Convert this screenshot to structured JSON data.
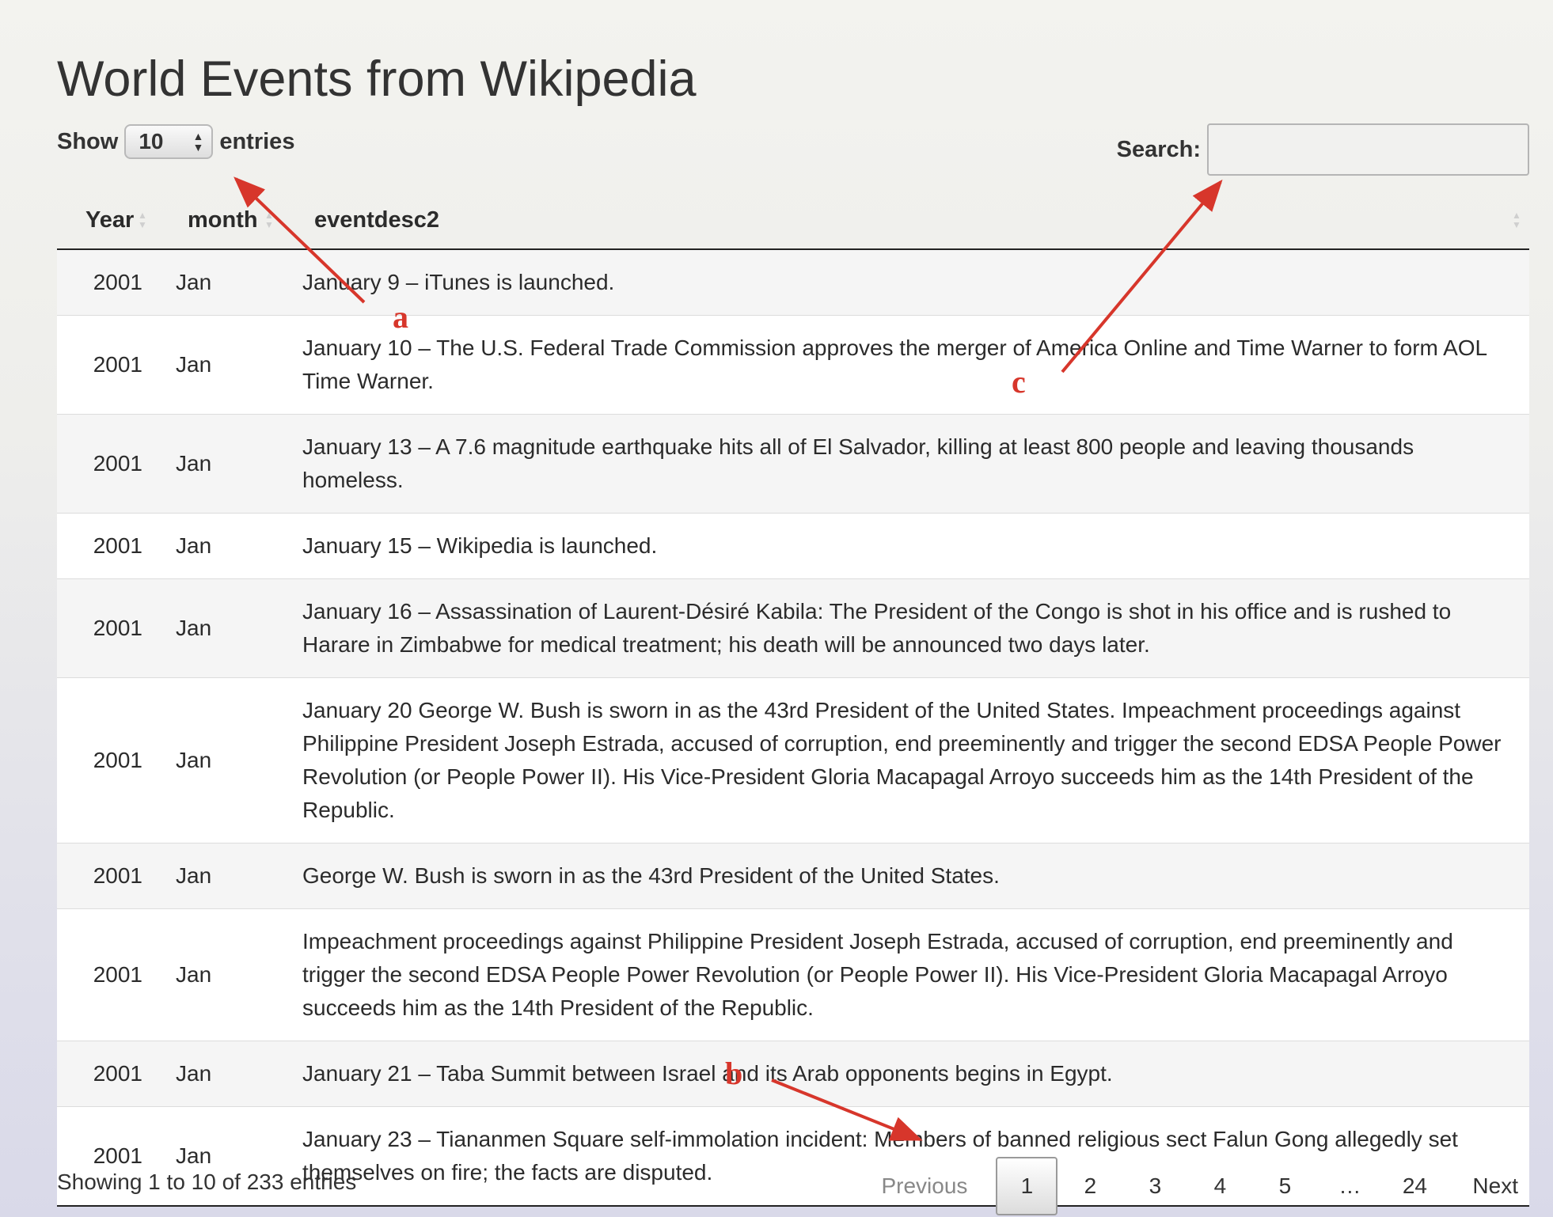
{
  "page": {
    "title": "World Events from Wikipedia"
  },
  "length": {
    "label_before": "Show",
    "selected": "10",
    "label_after": "entries"
  },
  "search": {
    "label": "Search:",
    "value": "",
    "placeholder": ""
  },
  "table": {
    "columns": [
      "Year",
      "month",
      "eventdesc2"
    ],
    "rows": [
      {
        "year": "2001",
        "month": "Jan",
        "desc": "January 9 – iTunes is launched."
      },
      {
        "year": "2001",
        "month": "Jan",
        "desc": "January 10 – The U.S. Federal Trade Commission approves the merger of America Online and Time Warner to form AOL Time Warner."
      },
      {
        "year": "2001",
        "month": "Jan",
        "desc": "January 13 – A 7.6 magnitude earthquake hits all of El Salvador, killing at least 800 people and leaving thousands homeless."
      },
      {
        "year": "2001",
        "month": "Jan",
        "desc": "January 15 – Wikipedia is launched."
      },
      {
        "year": "2001",
        "month": "Jan",
        "desc": "January 16 – Assassination of Laurent-Désiré Kabila: The President of the Congo is shot in his office and is rushed to Harare in Zimbabwe for medical treatment; his death will be announced two days later."
      },
      {
        "year": "2001",
        "month": "Jan",
        "desc": "January 20 George W. Bush is sworn in as the 43rd President of the United States. Impeachment proceedings against Philippine President Joseph Estrada, accused of corruption, end preeminently and trigger the second EDSA People Power Revolution (or People Power II). His Vice-President Gloria Macapagal Arroyo succeeds him as the 14th President of the Republic."
      },
      {
        "year": "2001",
        "month": "Jan",
        "desc": "George W. Bush is sworn in as the 43rd President of the United States."
      },
      {
        "year": "2001",
        "month": "Jan",
        "desc": "Impeachment proceedings against Philippine President Joseph Estrada, accused of corruption, end preeminently and trigger the second EDSA People Power Revolution (or People Power II). His Vice-President Gloria Macapagal Arroyo succeeds him as the 14th President of the Republic."
      },
      {
        "year": "2001",
        "month": "Jan",
        "desc": "January 21 – Taba Summit between Israel and its Arab opponents begins in Egypt."
      },
      {
        "year": "2001",
        "month": "Jan",
        "desc": "January 23 – Tiananmen Square self-immolation incident: Members of banned religious sect Falun Gong allegedly set themselves on fire; the facts are disputed."
      }
    ]
  },
  "info": {
    "text": "Showing 1 to 10 of 233 entries"
  },
  "pagination": {
    "previous": "Previous",
    "pages": [
      "1",
      "2",
      "3",
      "4",
      "5",
      "…",
      "24"
    ],
    "current": "1",
    "next": "Next"
  },
  "annotations": {
    "a": "a",
    "b": "b",
    "c": "c",
    "color": "#d7362b"
  },
  "icons": {
    "sort": "sort-icon",
    "select_arrows": "select-arrows-icon"
  }
}
